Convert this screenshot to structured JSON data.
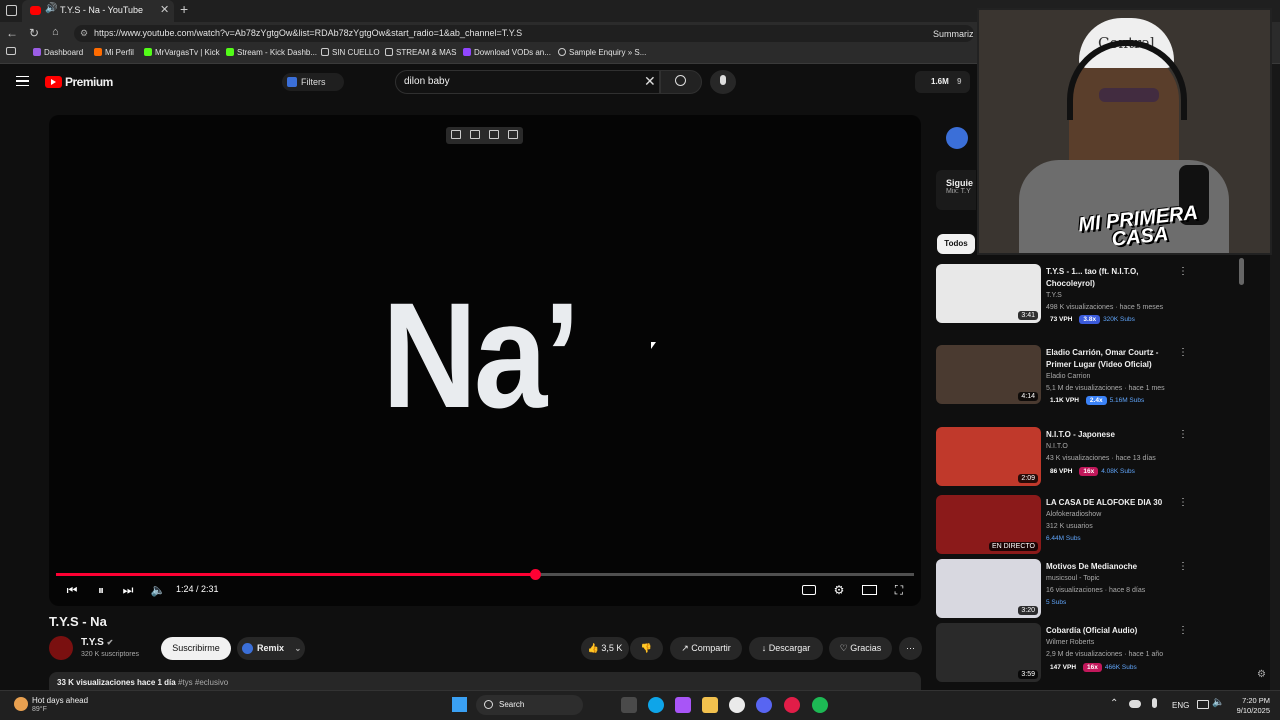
{
  "browser": {
    "tab_title": "T.Y.S - Na - YouTube",
    "url": "https://www.youtube.com/watch?v=Ab78zYgtgOw&list=RDAb78zYgtgOw&start_radio=1&ab_channel=T.Y.S",
    "extension_label": "Summariz",
    "bookmarks": [
      "Dashboard",
      "Mi Perfil",
      "MrVargasTv | Kick",
      "Stream - Kick Dashb...",
      "SIN CUELLO",
      "STREAM & MAS",
      "Download VODs an...",
      "Sample Enquiry » S..."
    ]
  },
  "youtube": {
    "logo_text": "Premium",
    "filters_label": "Filters",
    "search_value": "dilon baby",
    "stats_label": "1.6M",
    "stats_label2": "9"
  },
  "player": {
    "overlay_text": "Na’",
    "time": "1:24 / 2:31",
    "progress": 0.558
  },
  "video": {
    "title": "T.Y.S - Na",
    "channel": "T.Y.S",
    "subscribers": "320 K suscriptores",
    "subscribe_label": "Suscribirme",
    "remix_label": "Remix",
    "likes": "3,5 K",
    "share_label": "Compartir",
    "download_label": "Descargar",
    "thanks_label": "Gracias",
    "views_date": "33 K visualizaciones  hace 1 día",
    "tags": "#tys #eclusivo"
  },
  "sidebar": {
    "chip_label": "Todos",
    "mix_title": "Siguie",
    "mix_sub": "Mix: T.Y",
    "videos": [
      {
        "title": "T.Y.S - 1... tao (ft. N.I.T.O, Chocoleyrol)",
        "channel": "T.Y.S",
        "meta": "498 K visualizaciones · hace 5 meses",
        "vph": "73 VPH",
        "mult": "3.8x",
        "subs": "320K Subs",
        "duration": "3:41",
        "thumb_color": "#e8e8e8",
        "mult_color": "#3b5bdb"
      },
      {
        "title": "Eladio Carrión, Omar Courtz - Primer Lugar (Video Oficial)",
        "channel": "Eladio Carrion",
        "meta": "5,1 M de visualizaciones · hace 1 mes",
        "vph": "1.1K VPH",
        "mult": "2.4x",
        "subs": "5.16M Subs",
        "duration": "4:14",
        "thumb_color": "#4a3a30",
        "mult_color": "#3b82f6"
      },
      {
        "title": "N.I.T.O - Japonese",
        "channel": "N.I.T.O",
        "meta": "43 K visualizaciones · hace 13 días",
        "vph": "86 VPH",
        "mult": "16x",
        "subs": "4.08K Subs",
        "duration": "2:09",
        "thumb_color": "#c0392b",
        "mult_color": "#c2185b"
      },
      {
        "title": "LA CASA DE ALOFOKE DIA 30",
        "channel": "Alofokeradioshow",
        "meta": "312 K usuarios",
        "vph": "",
        "mult": "",
        "subs": "6.44M Subs",
        "duration": "EN DIRECTO",
        "thumb_color": "#8b1a1a",
        "mult_color": "#3b82f6"
      },
      {
        "title": "Motivos De Medianoche",
        "channel": "musicsoul - Topic",
        "meta": "16 visualizaciones · hace 8 días",
        "vph": "",
        "mult": "",
        "subs": "5 Subs",
        "duration": "3:20",
        "thumb_color": "#d8d8e0",
        "mult_color": "#3b82f6"
      },
      {
        "title": "Cobardía (Oficial Audio)",
        "channel": "Wilmer Roberts",
        "meta": "2,9 M de visualizaciones · hace 1 año",
        "vph": "147 VPH",
        "mult": "16x",
        "subs": "466K Subs",
        "duration": "3:59",
        "thumb_color": "#2a2a2a",
        "mult_color": "#c2185b"
      }
    ]
  },
  "webcam": {
    "cap_text": "Central",
    "overlay_text": "MI PRIMERA CASA"
  },
  "taskbar": {
    "weather_title": "Hot days ahead",
    "weather_temp": "89°F",
    "search_label": "Search",
    "lang": "ENG",
    "time": "7:20 PM",
    "date": "9/10/2025"
  }
}
